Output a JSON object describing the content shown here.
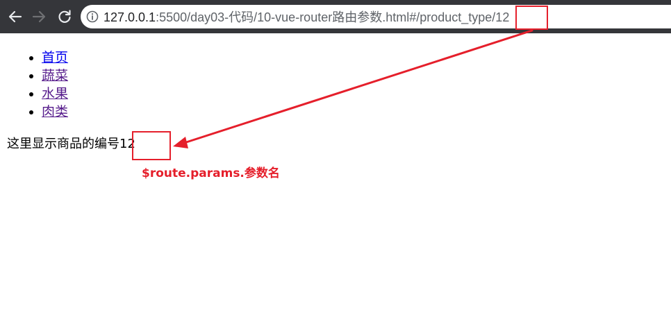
{
  "browser": {
    "url_host": "127.0.0.1",
    "url_path": ":5500/day03-代码/10-vue-router路由参数.html#/product_type/12",
    "icons": {
      "back": "back-arrow-icon",
      "forward": "forward-arrow-icon",
      "reload": "reload-icon",
      "info": "info-icon"
    }
  },
  "nav": {
    "items": [
      {
        "label": "首页",
        "link_state": "unvisited"
      },
      {
        "label": "蔬菜",
        "link_state": "visited"
      },
      {
        "label": "水果",
        "link_state": "visited"
      },
      {
        "label": "肉类",
        "link_state": "visited"
      }
    ]
  },
  "content": {
    "product_prefix": "这里显示商品的编号",
    "product_id": "12"
  },
  "annotation": {
    "label": "$route.params.参数名",
    "color": "#e51f2b"
  },
  "colors": {
    "toolbar": "#35363a",
    "link_unvisited": "#0000ee",
    "link_visited": "#551a8b"
  }
}
